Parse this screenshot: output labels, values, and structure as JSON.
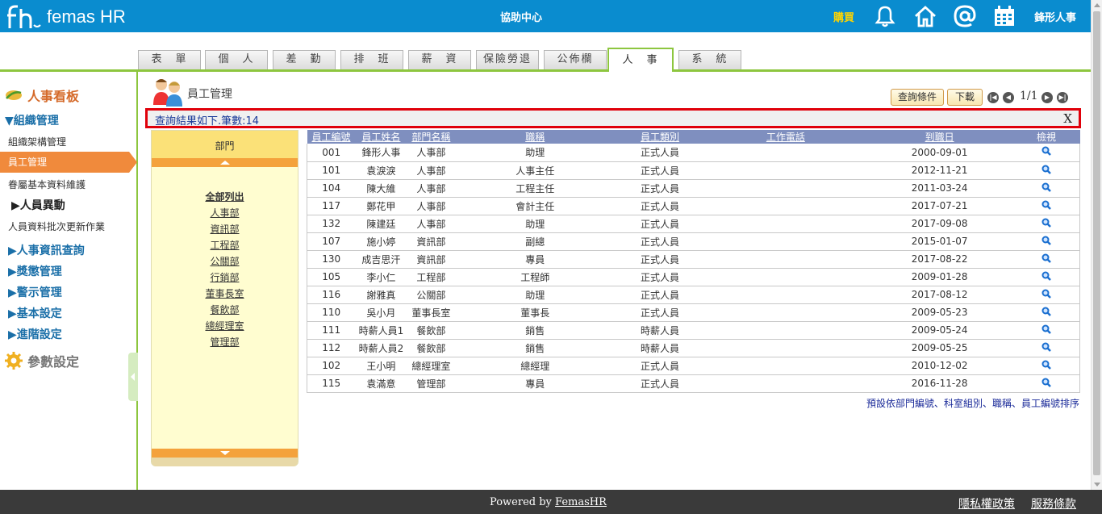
{
  "header": {
    "logo_text": "femas HR",
    "help_center": "協助中心",
    "buy": "購買",
    "user": "鋒形人事",
    "icons": [
      "bell-icon",
      "home-icon",
      "at-icon",
      "calendar-icon"
    ]
  },
  "tabs": [
    {
      "label": "表　單",
      "active": false
    },
    {
      "label": "個　人",
      "active": false
    },
    {
      "label": "差　勤",
      "active": false
    },
    {
      "label": "排　班",
      "active": false
    },
    {
      "label": "薪　資",
      "active": false
    },
    {
      "label": "保險勞退",
      "active": false
    },
    {
      "label": "公佈欄",
      "active": false
    },
    {
      "label": "人　事",
      "active": true
    },
    {
      "label": "系　統",
      "active": false
    }
  ],
  "sidebar": {
    "title": "人事看板",
    "org_section": "▼組織管理",
    "items": [
      "組織架構管理",
      "員工管理",
      "眷屬基本資料維護"
    ],
    "sub_section": "▶人員異動",
    "batch_item": "人員資料批次更新作業",
    "sections": [
      "▶人事資訊查詢",
      "▶獎懲管理",
      "▶警示管理",
      "▶基本設定",
      "▶進階設定"
    ],
    "params": "參數設定"
  },
  "page": {
    "title": "員工管理",
    "query_button": "查詢條件",
    "download_button": "下載",
    "page_indicator": "1/1",
    "result_text": "查詢結果如下.筆數:14",
    "close_label": "X",
    "sort_note": "預設依部門編號、科室組別、職稱、員工編號排序"
  },
  "departments": {
    "header": "部門",
    "items": [
      "全部列出",
      "人事部",
      "資訊部",
      "工程部",
      "公關部",
      "行銷部",
      "董事長室",
      "餐飲部",
      "總經理室",
      "管理部"
    ]
  },
  "table": {
    "columns": [
      "員工編號",
      "員工姓名",
      "部門名稱",
      "職稱",
      "員工類別",
      "工作電話",
      "到職日",
      "檢視"
    ],
    "rows": [
      [
        "001",
        "鋒形人事",
        "人事部",
        "助理",
        "正式人員",
        "",
        "2000-09-01"
      ],
      [
        "101",
        "袁淚淚",
        "人事部",
        "人事主任",
        "正式人員",
        "",
        "2012-11-21"
      ],
      [
        "104",
        "陳大維",
        "人事部",
        "工程主任",
        "正式人員",
        "",
        "2011-03-24"
      ],
      [
        "117",
        "鄭花甲",
        "人事部",
        "會計主任",
        "正式人員",
        "",
        "2017-07-21"
      ],
      [
        "132",
        "陳建廷",
        "人事部",
        "助理",
        "正式人員",
        "",
        "2017-09-08"
      ],
      [
        "107",
        "施小婷",
        "資訊部",
        "副總",
        "正式人員",
        "",
        "2015-01-07"
      ],
      [
        "130",
        "成吉思汗",
        "資訊部",
        "專員",
        "正式人員",
        "",
        "2017-08-22"
      ],
      [
        "105",
        "李小仁",
        "工程部",
        "工程師",
        "正式人員",
        "",
        "2009-01-28"
      ],
      [
        "116",
        "謝雅真",
        "公關部",
        "助理",
        "正式人員",
        "",
        "2017-08-12"
      ],
      [
        "110",
        "吳小月",
        "董事長室",
        "董事長",
        "正式人員",
        "",
        "2009-05-23"
      ],
      [
        "111",
        "時薪人員1",
        "餐飲部",
        "銷售",
        "時薪人員",
        "",
        "2009-05-24"
      ],
      [
        "112",
        "時薪人員2",
        "餐飲部",
        "銷售",
        "時薪人員",
        "",
        "2009-05-25"
      ],
      [
        "102",
        "王小明",
        "總經理室",
        "總經理",
        "正式人員",
        "",
        "2010-12-02"
      ],
      [
        "115",
        "袁滿意",
        "管理部",
        "專員",
        "正式人員",
        "",
        "2016-11-28"
      ]
    ]
  },
  "footer": {
    "powered_prefix": "Powered by ",
    "powered_link": "FemasHR",
    "privacy": "隱私權政策",
    "terms": "服務條款"
  },
  "colors": {
    "header_bg": "#0a8ccf",
    "accent_green": "#8dc63f",
    "active_orange": "#f08a3c",
    "table_header": "#7f8fbf",
    "highlight_red": "#e0000a"
  }
}
